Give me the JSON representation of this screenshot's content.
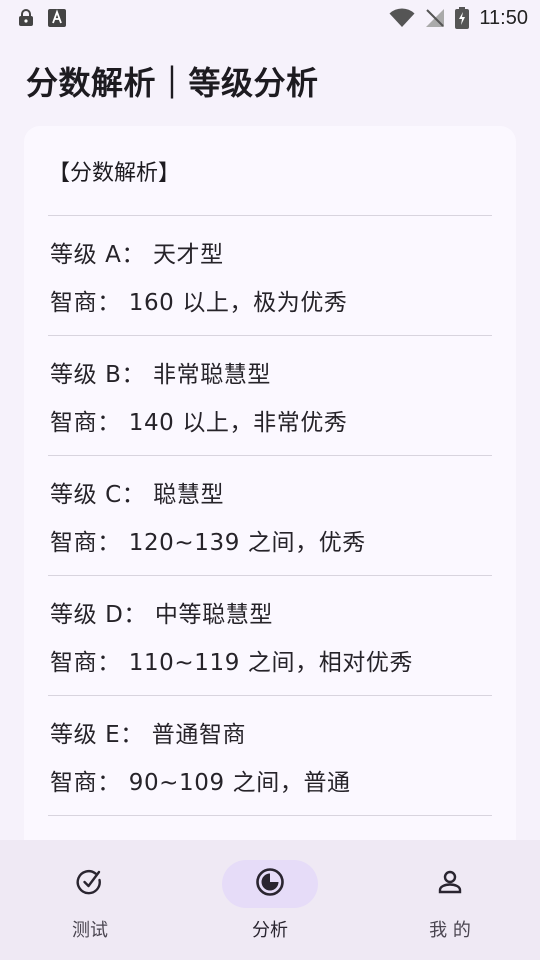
{
  "status_bar": {
    "time": "11:50",
    "left_icons": [
      "lock-icon",
      "font-icon"
    ],
    "right_icons": [
      "wifi-icon",
      "no-signal-icon",
      "battery-charging-icon"
    ]
  },
  "header": {
    "title": "分数解析｜等级分析"
  },
  "card": {
    "heading": "【分数解析】",
    "grades": [
      {
        "grade": "等级 A： 天才型",
        "iq": "智商： 160 以上，极为优秀"
      },
      {
        "grade": "等级 B： 非常聪慧型",
        "iq": "智商： 140 以上，非常优秀"
      },
      {
        "grade": "等级 C： 聪慧型",
        "iq": "智商： 120~139 之间，优秀"
      },
      {
        "grade": "等级 D： 中等聪慧型",
        "iq": "智商： 110~119 之间，相对优秀"
      },
      {
        "grade": "等级 E： 普通智商",
        "iq": "智商： 90~109 之间，普通"
      }
    ]
  },
  "bottom_nav": {
    "items": [
      {
        "label": "测试",
        "icon": "test-icon",
        "active": false
      },
      {
        "label": "分析",
        "icon": "analysis-icon",
        "active": true
      },
      {
        "label": "我 的",
        "icon": "person-icon",
        "active": false
      }
    ]
  },
  "colors": {
    "background": "#f6f2fb",
    "card": "#fbf8ff",
    "nav_background": "#efe9f4",
    "active_pill": "#e6dcf8",
    "divider": "#d8d4de"
  }
}
